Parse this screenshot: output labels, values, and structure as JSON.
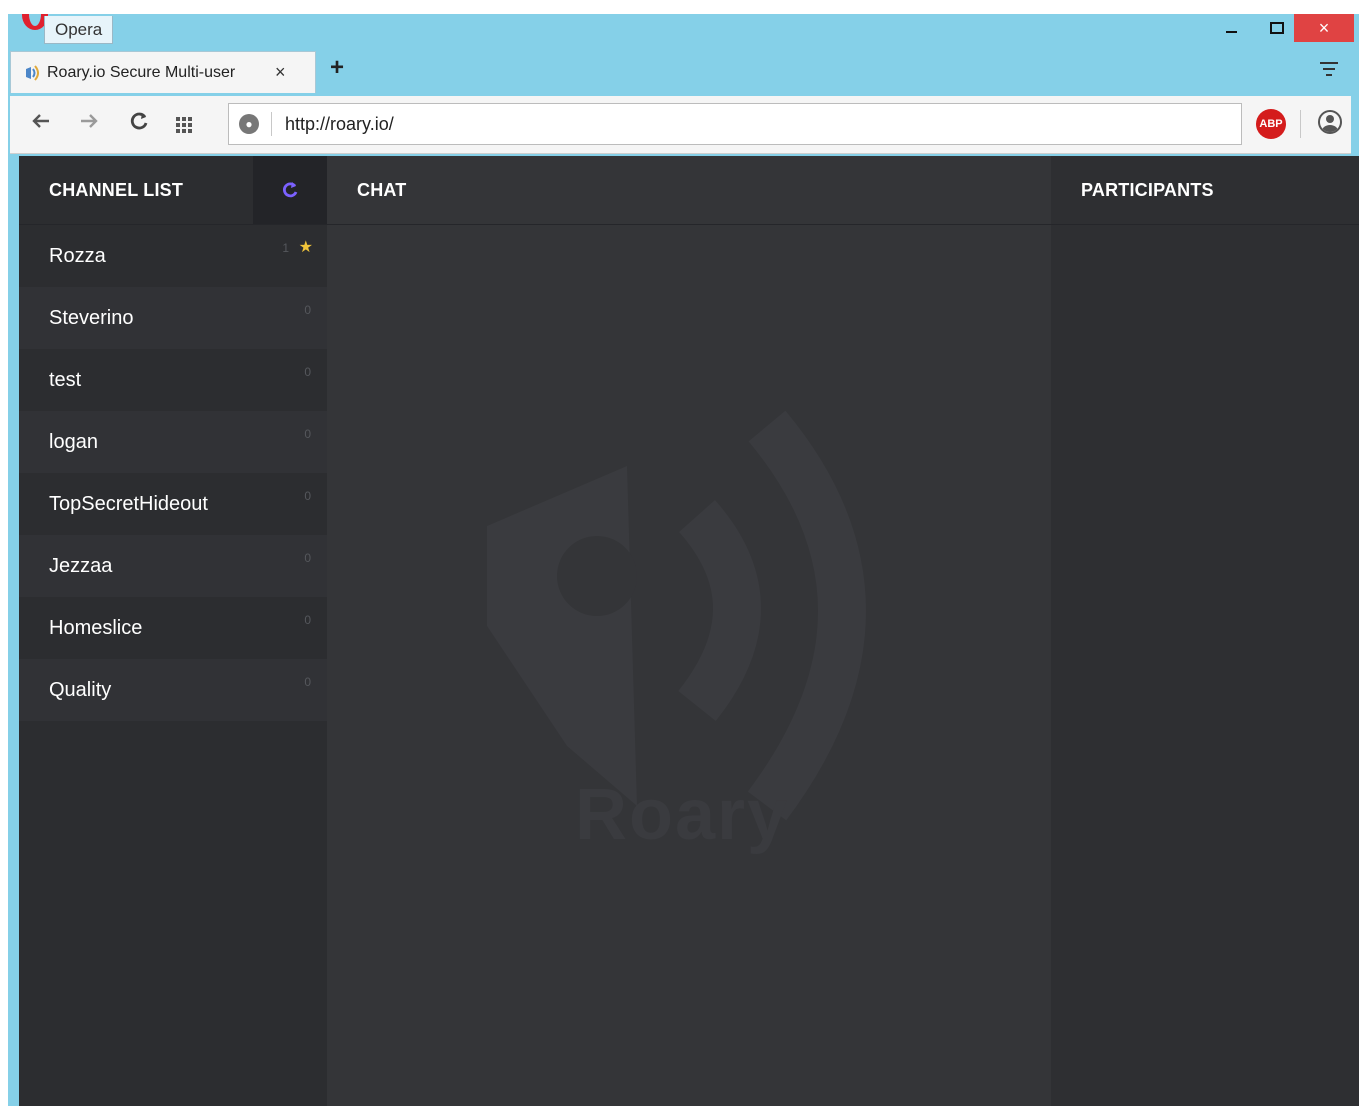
{
  "browser": {
    "app_name": "Opera",
    "tab": {
      "title": "Roary.io Secure Multi-user",
      "close_glyph": "×"
    },
    "new_tab_glyph": "+",
    "url": "http://roary.io/",
    "window_close_glyph": "×",
    "abp_label": "ABP"
  },
  "app": {
    "channel_list": {
      "header": "CHANNEL LIST",
      "refresh_glyph": "C",
      "items": [
        {
          "name": "Rozza",
          "count": "1",
          "starred": true
        },
        {
          "name": "Steverino",
          "count": "0"
        },
        {
          "name": "test",
          "count": "0"
        },
        {
          "name": "logan",
          "count": "0"
        },
        {
          "name": "TopSecretHideout",
          "count": "0"
        },
        {
          "name": "Jezzaa",
          "count": "0"
        },
        {
          "name": "Homeslice",
          "count": "0"
        },
        {
          "name": "Quality",
          "count": "0"
        }
      ]
    },
    "chat": {
      "header": "CHAT",
      "watermark_text": "Roary"
    },
    "participants": {
      "header": "PARTICIPANTS"
    }
  },
  "colors": {
    "accent": "#7b61ff",
    "star": "#f0c43a",
    "background": "#343538",
    "sidebar": "#2c2d30"
  }
}
